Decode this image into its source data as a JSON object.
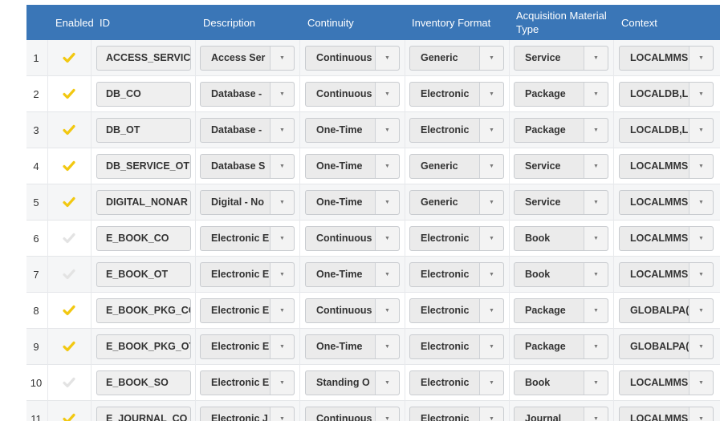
{
  "headers": {
    "enabled": "Enabled",
    "id": "ID",
    "description": "Description",
    "continuity": "Continuity",
    "inventory_format": "Inventory Format",
    "acq_line1": "Acquisition Material",
    "acq_line2": "Type",
    "context": "Context"
  },
  "colors": {
    "header_bg": "#3a76b7",
    "check_enabled": "#f2c811",
    "check_disabled": "#e3e3e3"
  },
  "dropdown_icon": "chevron-down-icon",
  "rows": [
    {
      "num": "1",
      "enabled": true,
      "id": "ACCESS_SERVIC",
      "description": "Access Ser",
      "continuity": "Continuous",
      "format": "Generic",
      "acq": "Service",
      "context": "LOCALMMS"
    },
    {
      "num": "2",
      "enabled": true,
      "id": "DB_CO",
      "description": "Database -",
      "continuity": "Continuous",
      "format": "Electronic",
      "acq": "Package",
      "context": "LOCALDB,L"
    },
    {
      "num": "3",
      "enabled": true,
      "id": "DB_OT",
      "description": "Database -",
      "continuity": "One-Time",
      "format": "Electronic",
      "acq": "Package",
      "context": "LOCALDB,L"
    },
    {
      "num": "4",
      "enabled": true,
      "id": "DB_SERVICE_OT",
      "description": "Database S",
      "continuity": "One-Time",
      "format": "Generic",
      "acq": "Service",
      "context": "LOCALMMS"
    },
    {
      "num": "5",
      "enabled": true,
      "id": "DIGITAL_NONAR",
      "description": "Digital - No",
      "continuity": "One-Time",
      "format": "Generic",
      "acq": "Service",
      "context": "LOCALMMS"
    },
    {
      "num": "6",
      "enabled": false,
      "id": "E_BOOK_CO",
      "description": "Electronic E",
      "continuity": "Continuous",
      "format": "Electronic",
      "acq": "Book",
      "context": "LOCALMMS"
    },
    {
      "num": "7",
      "enabled": false,
      "id": "E_BOOK_OT",
      "description": "Electronic E",
      "continuity": "One-Time",
      "format": "Electronic",
      "acq": "Book",
      "context": "LOCALMMS"
    },
    {
      "num": "8",
      "enabled": true,
      "id": "E_BOOK_PKG_CC",
      "description": "Electronic E",
      "continuity": "Continuous",
      "format": "Electronic",
      "acq": "Package",
      "context": "GLOBALPA("
    },
    {
      "num": "9",
      "enabled": true,
      "id": "E_BOOK_PKG_OT",
      "description": "Electronic E",
      "continuity": "One-Time",
      "format": "Electronic",
      "acq": "Package",
      "context": "GLOBALPA("
    },
    {
      "num": "10",
      "enabled": false,
      "id": "E_BOOK_SO",
      "description": "Electronic E",
      "continuity": "Standing O",
      "format": "Electronic",
      "acq": "Book",
      "context": "LOCALMMS"
    },
    {
      "num": "11",
      "enabled": true,
      "id": "E_JOURNAL_CO",
      "description": "Electronic J",
      "continuity": "Continuous",
      "format": "Electronic",
      "acq": "Journal",
      "context": "LOCALMMS"
    }
  ]
}
